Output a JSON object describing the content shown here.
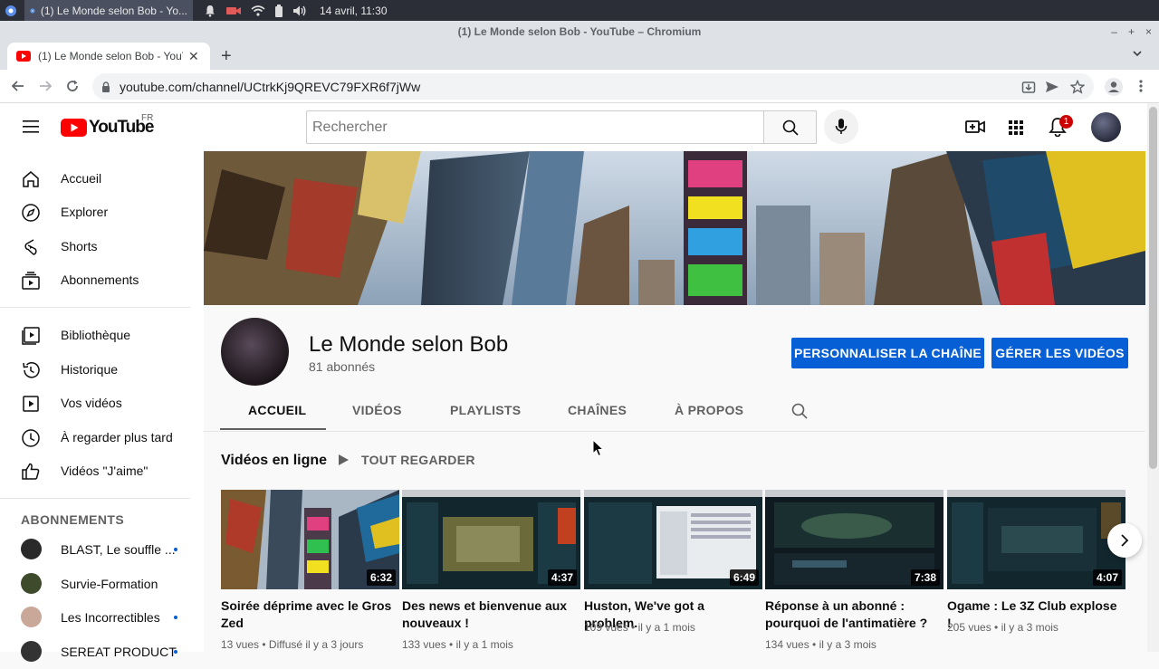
{
  "os": {
    "taskbar_task_title": "(1) Le Monde selon Bob - Yo...",
    "clock": "14 avril, 11:30"
  },
  "browser": {
    "window_title": "(1) Le Monde selon Bob - YouTube – Chromium",
    "tab_title": "(1) Le Monde selon Bob - YouTube",
    "url": "youtube.com/channel/UCtrkKj9QREVC79FXR6f7jWw"
  },
  "header": {
    "logo_text": "YouTube",
    "region": "FR",
    "search_placeholder": "Rechercher",
    "notification_count": "1"
  },
  "sidebar": {
    "items": [
      {
        "label": "Accueil",
        "icon": "home-icon"
      },
      {
        "label": "Explorer",
        "icon": "compass-icon"
      },
      {
        "label": "Shorts",
        "icon": "shorts-icon"
      },
      {
        "label": "Abonnements",
        "icon": "subscriptions-icon"
      }
    ],
    "items2": [
      {
        "label": "Bibliothèque",
        "icon": "library-icon"
      },
      {
        "label": "Historique",
        "icon": "history-icon"
      },
      {
        "label": "Vos vidéos",
        "icon": "your-videos-icon"
      },
      {
        "label": "À regarder plus tard",
        "icon": "watch-later-icon"
      },
      {
        "label": "Vidéos \"J'aime\"",
        "icon": "thumbs-up-icon"
      }
    ],
    "subscriptions_heading": "ABONNEMENTS",
    "subscriptions": [
      {
        "name": "BLAST, Le souffle ...",
        "avatar_color": "#2a2a2a",
        "new": true
      },
      {
        "name": "Survie-Formation",
        "avatar_color": "#3d4a2c",
        "new": false
      },
      {
        "name": "Les Incorrectibles",
        "avatar_color": "#c9a89a",
        "new": true
      },
      {
        "name": "SEREAT PRODUCT",
        "avatar_color": "#333333",
        "new": true
      }
    ]
  },
  "channel": {
    "name": "Le Monde selon Bob",
    "subscribers": "81 abonnés",
    "customize_button": "PERSONNALISER LA CHAÎNE",
    "manage_button": "GÉRER LES VIDÉOS",
    "tabs": [
      "ACCUEIL",
      "VIDÉOS",
      "PLAYLISTS",
      "CHAÎNES",
      "À PROPOS"
    ],
    "active_tab": "ACCUEIL"
  },
  "section": {
    "title": "Vidéos en ligne",
    "play_all": "TOUT REGARDER"
  },
  "videos": [
    {
      "title": "Soirée déprime avec le Gros Zed",
      "duration": "6:32",
      "views": "13 vues",
      "age": "Diffusé il y a 3 jours"
    },
    {
      "title": "Des news et bienvenue aux nouveaux !",
      "duration": "4:37",
      "views": "133 vues",
      "age": "il y a 1 mois"
    },
    {
      "title": "Huston, We've got a problem.",
      "duration": "6:49",
      "views": "109 vues",
      "age": "il y a 1 mois"
    },
    {
      "title": "Réponse à un abonné : pourquoi de l'antimatière ?",
      "duration": "7:38",
      "views": "134 vues",
      "age": "il y a 3 mois"
    },
    {
      "title": "Ogame : Le 3Z Club explose !",
      "duration": "4:07",
      "views": "205 vues",
      "age": "il y a 3 mois"
    }
  ],
  "colors": {
    "brand_red": "#ff0000",
    "accent_blue": "#065fd4"
  }
}
